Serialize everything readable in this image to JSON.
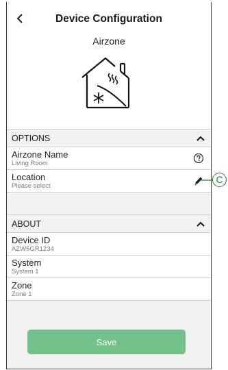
{
  "header": {
    "title": "Device Configuration",
    "subtitle": "Airzone"
  },
  "options": {
    "heading": "OPTIONS",
    "rows": [
      {
        "label": "Airzone Name",
        "value": "Living Room",
        "action_icon": "help-circle-icon"
      },
      {
        "label": "Location",
        "value": "Please select",
        "action_icon": "pencil-icon"
      }
    ]
  },
  "about": {
    "heading": "ABOUT",
    "rows": [
      {
        "label": "Device ID",
        "value": "AZW5GR1234"
      },
      {
        "label": "System",
        "value": "System 1"
      },
      {
        "label": "Zone",
        "value": "Zone 1"
      }
    ]
  },
  "footer": {
    "save_label": "Save"
  },
  "callout": {
    "letter": "C"
  },
  "colors": {
    "accent": "#72c08a",
    "callout": "#2e7d32",
    "section_bg": "#f2f2f2",
    "divider": "#cfcfcf"
  }
}
